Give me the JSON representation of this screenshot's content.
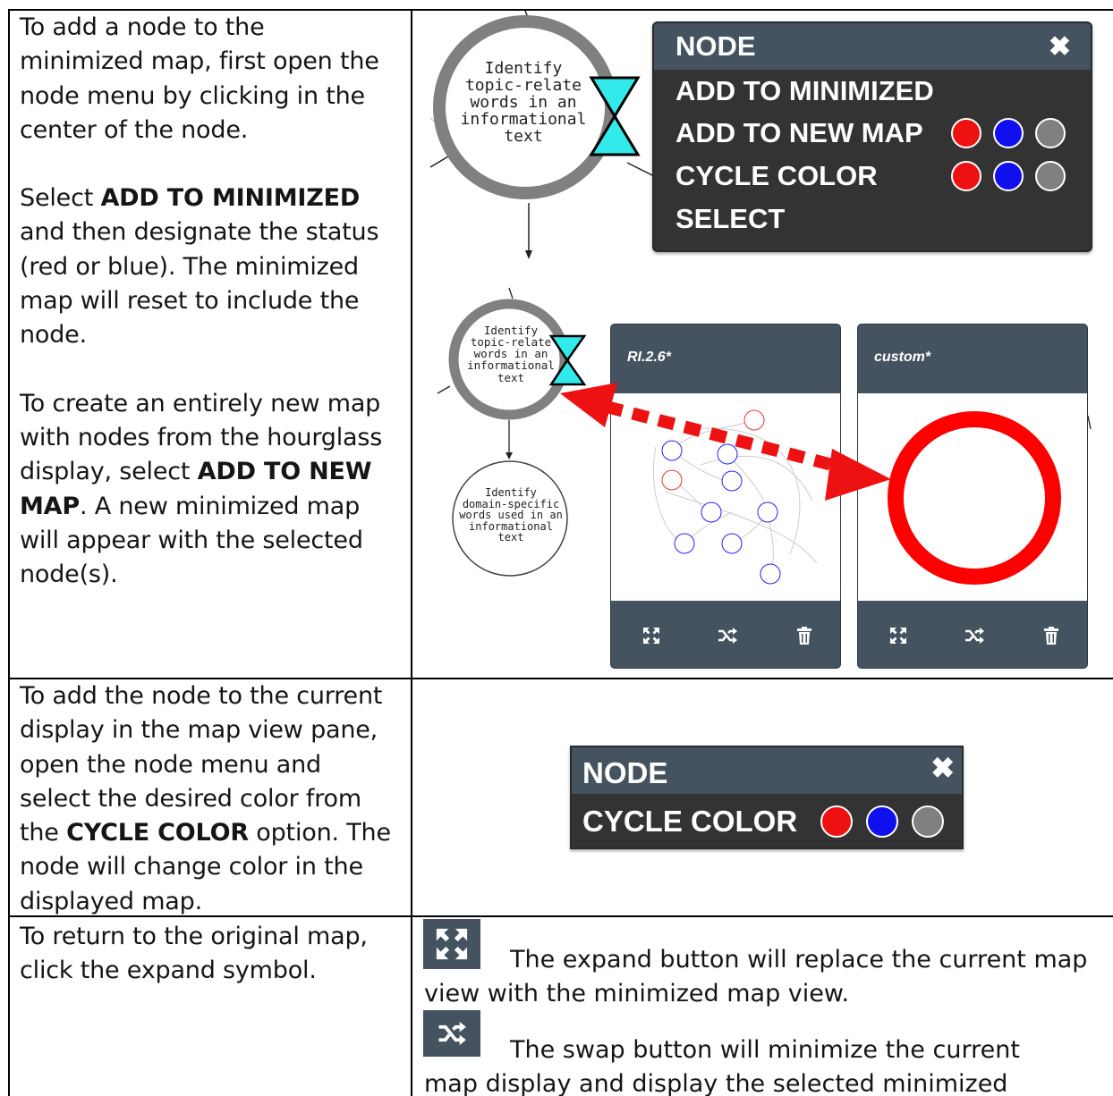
{
  "row1": {
    "p1": "To add a node to the minimized map, first open the node menu by clicking in the center of the node.",
    "p2_pre": "Select ",
    "p2_bold": "ADD TO MINIMIZED",
    "p2_post": " and then designate the status (red or blue). The minimized map will reset to include the node.",
    "p3_pre": "To create an entirely new map with nodes from the hourglass display, select ",
    "p3_bold": "ADD TO NEW MAP",
    "p3_post": ". A new minimized map will appear with the selected node(s)."
  },
  "row2": {
    "p_pre": "To add the node to the current display in the map view pane, open the node menu and select the desired color from the ",
    "p_bold": "CYCLE COLOR",
    "p_post": " option. The node will change color in the displayed map."
  },
  "row3": {
    "p": "To return to the original map, click the expand symbol.",
    "expand_text": "The expand button will replace the current map view with the minimized map view.",
    "swap_text": "The swap button will minimize the current map display and display the selected minimized map."
  },
  "node_menu_full": {
    "title": "NODE",
    "close": "✖",
    "items": [
      "ADD TO MINIMIZED",
      "ADD TO NEW MAP",
      "CYCLE COLOR",
      "SELECT"
    ]
  },
  "node_menu_small": {
    "title": "NODE",
    "close": "✖",
    "item": "CYCLE COLOR"
  },
  "graph_nodes": {
    "top_node": "Identify\ntopic-relate\nwords in an\ninformational\ntext",
    "mid_node": "Identify\ntopic-relate\nwords in an\ninformational\ntext",
    "bottom_node": "Identify\ndomain-specific\nwords used in an\ninformational\ntext"
  },
  "mini_maps": [
    {
      "title": "RI.2.6*"
    },
    {
      "title": "custom*"
    }
  ],
  "icons": {
    "expand": "expand-icon",
    "swap": "shuffle-icon",
    "delete": "trash-icon"
  },
  "colors": {
    "menu_bg": "#333333",
    "menu_head": "#44535f",
    "red": "#ee1111",
    "blue": "#1010ee",
    "gray": "#808080",
    "hourglass": "#33eaea"
  }
}
